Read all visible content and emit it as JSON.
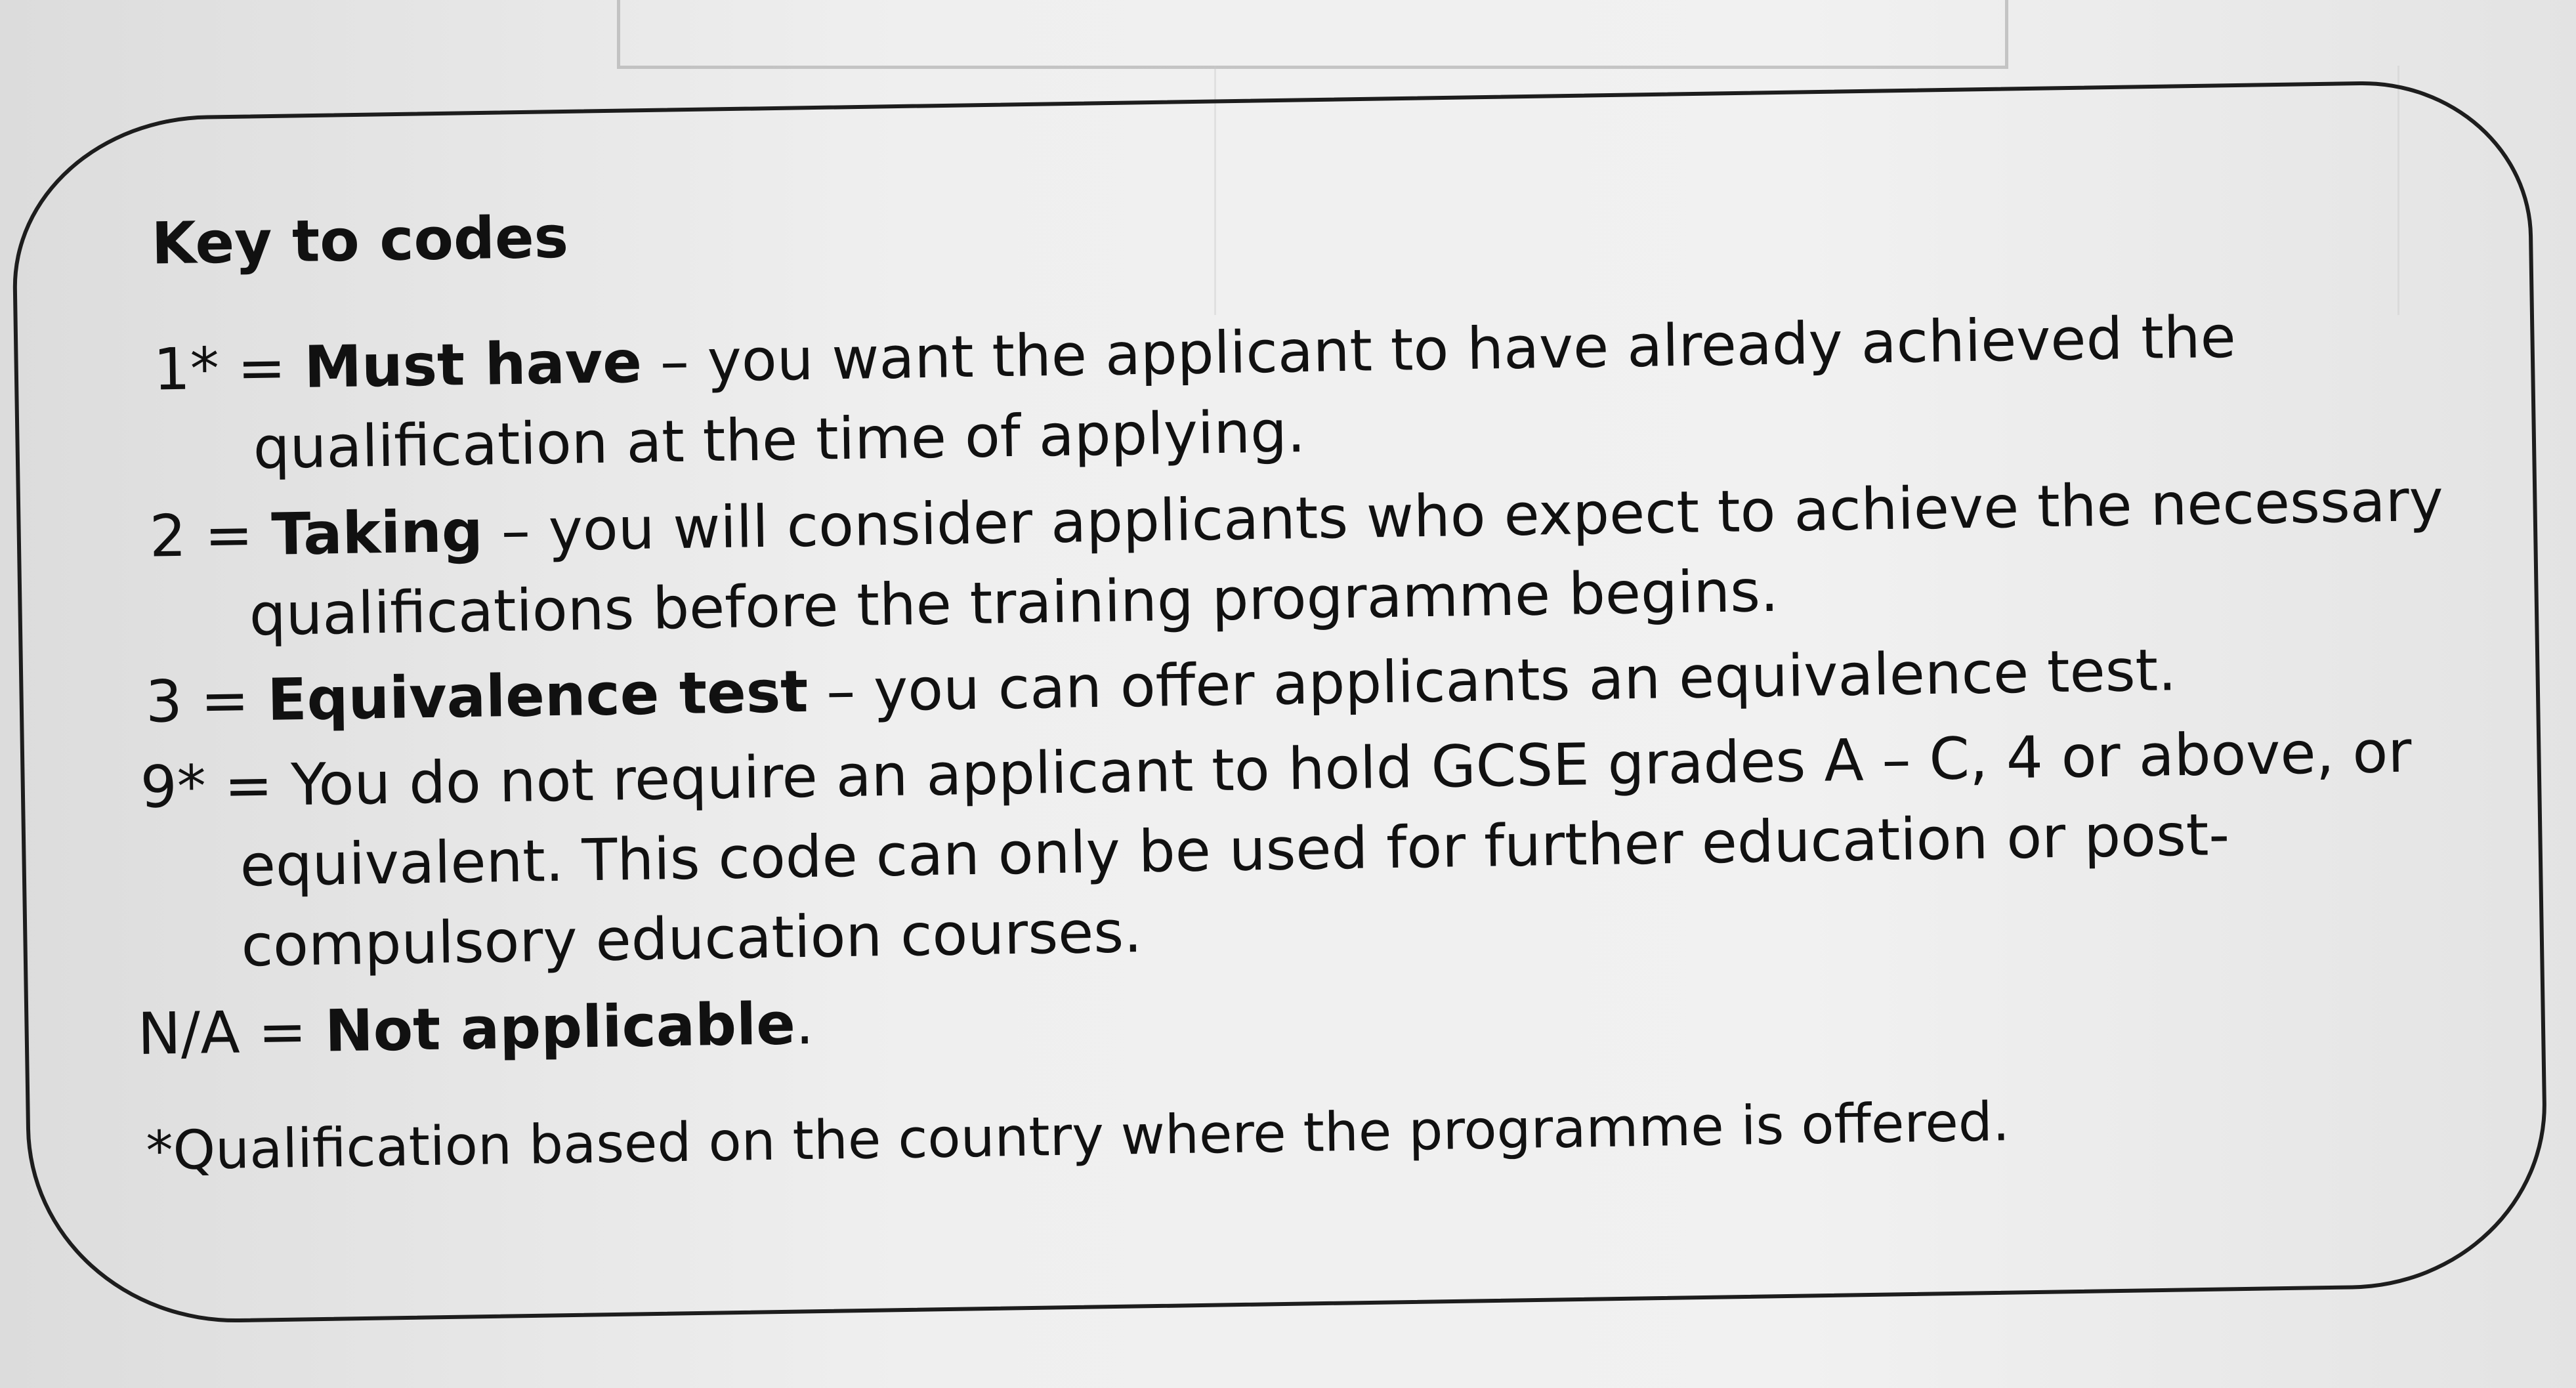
{
  "key": {
    "title": "Key to codes",
    "entries": [
      {
        "code": "1* = ",
        "term": "Must have",
        "desc_first": " – you want the applicant to have already achieved the",
        "desc_cont": "qualification at the time of applying."
      },
      {
        "code": "2 = ",
        "term": "Taking",
        "desc_first": " – you will consider applicants who expect to achieve the necessary",
        "desc_cont": "qualifications before the training programme begins."
      },
      {
        "code": "3 = ",
        "term": "Equivalence test",
        "desc_first": " – you can offer applicants an equivalence test.",
        "desc_cont": ""
      },
      {
        "code": "9* = ",
        "term": "",
        "desc_first": "You do not require an applicant to hold GCSE grades A – C, 4 or above, or",
        "desc_cont": "equivalent. This code can only be used for further education or post-",
        "desc_cont2": "compulsory education courses."
      },
      {
        "code": "N/A = ",
        "term": "Not applicable",
        "desc_first": ".",
        "desc_cont": ""
      }
    ],
    "footnote": "*Qualification based on the country where the programme is offered."
  }
}
